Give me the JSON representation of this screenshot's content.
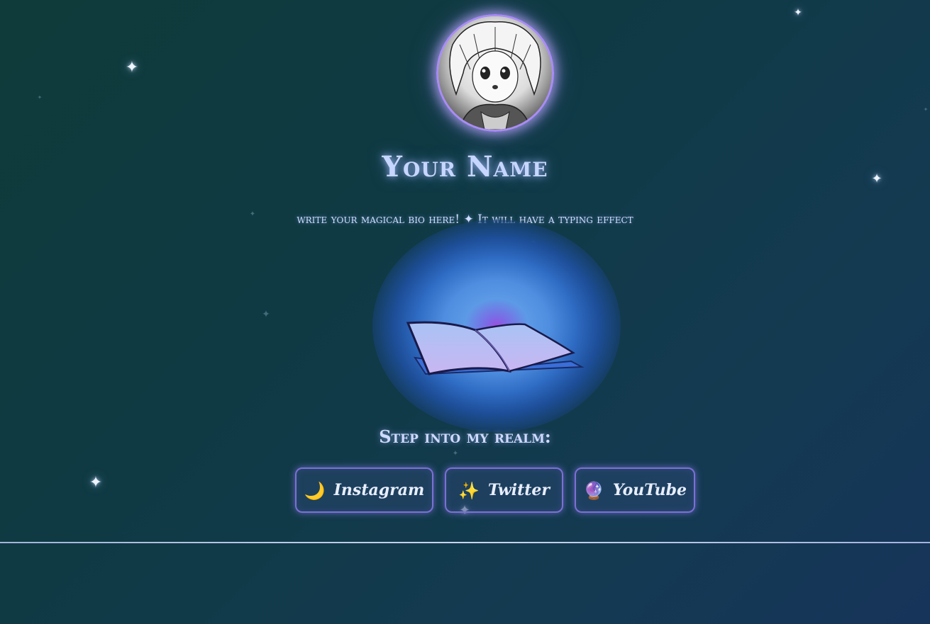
{
  "profile": {
    "avatar_alt": "anime character avatar",
    "name": "Your Name",
    "bio": "write your magical bio here! ✦ It will have a typing effect"
  },
  "realm": {
    "heading": "Step into my realm:"
  },
  "links": [
    {
      "icon": "🌙",
      "label": "Instagram"
    },
    {
      "icon": "✨",
      "label": "Twitter"
    },
    {
      "icon": "🔮",
      "label": "YouTube"
    }
  ],
  "colors": {
    "accent": "#a98cf6",
    "text_glow": "#c7d6ff",
    "orb_center": "#9a4fe0",
    "orb_outer": "#4f8ee0"
  },
  "icons": {
    "sparkle": "✦",
    "book": "open-book-icon"
  }
}
